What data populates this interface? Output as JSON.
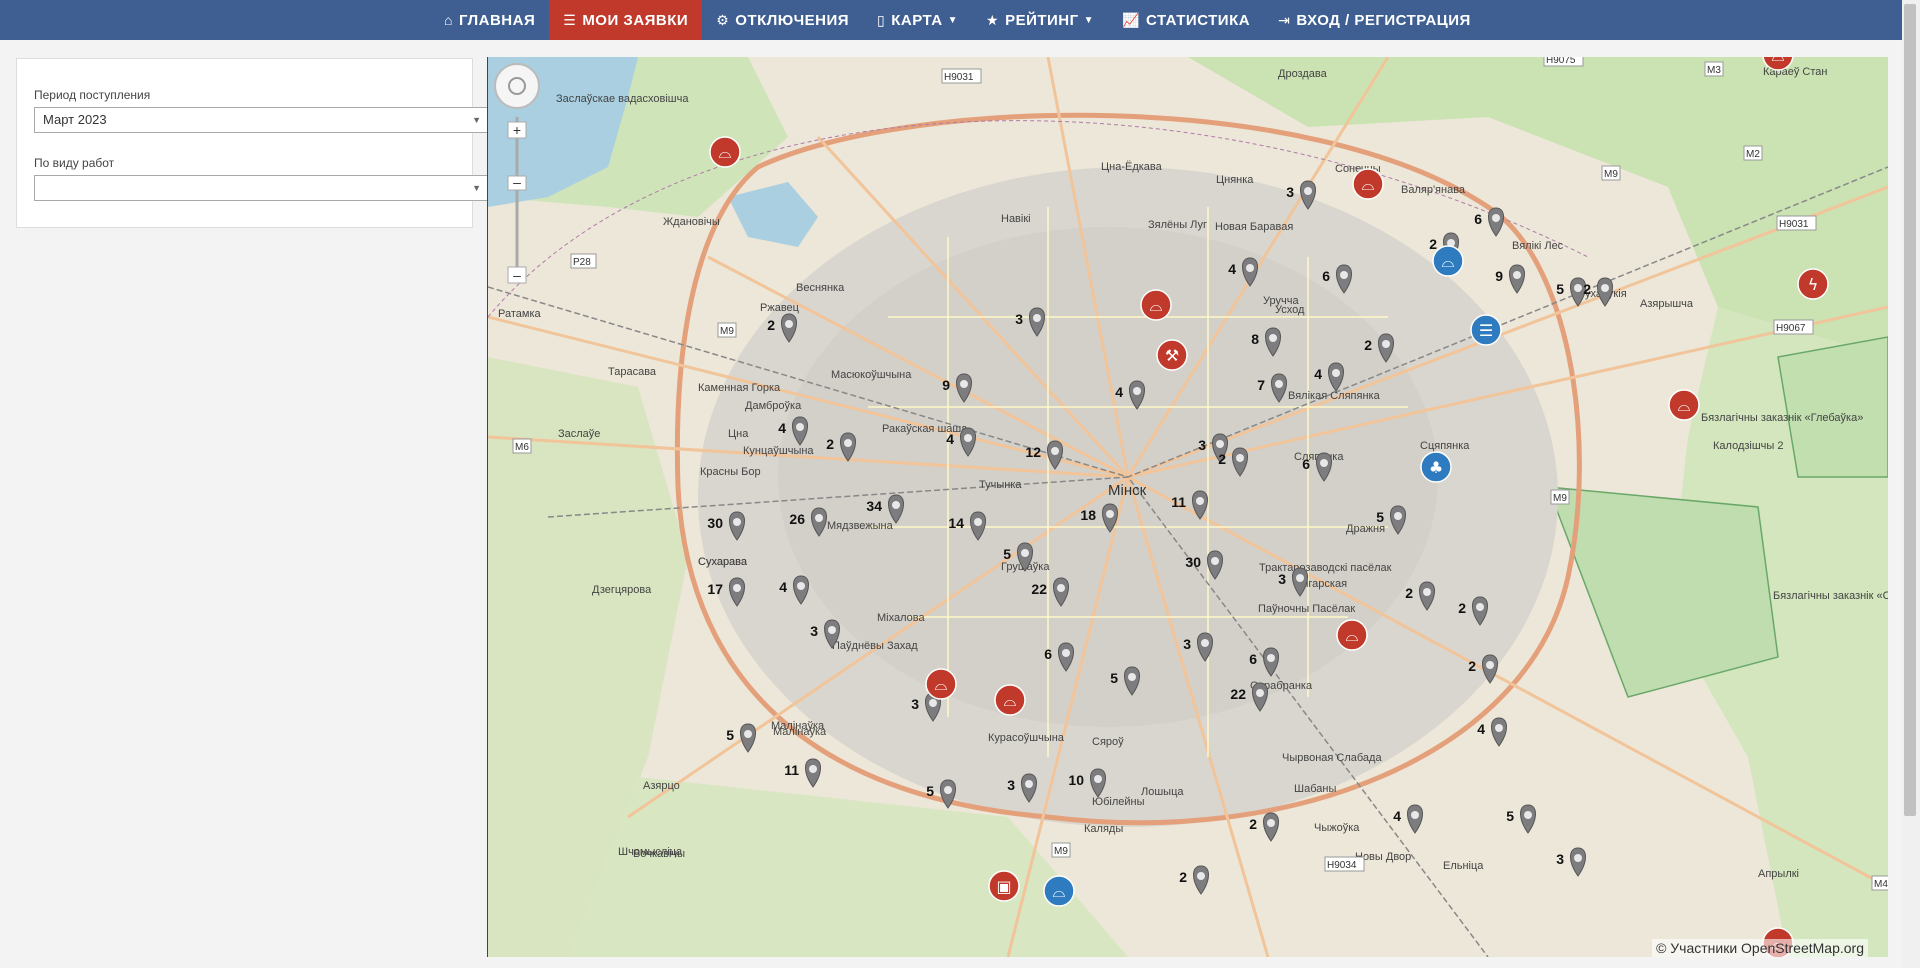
{
  "nav": {
    "items": [
      {
        "label": "ГЛАВНАЯ",
        "icon": "home-icon"
      },
      {
        "label": "МОИ ЗАЯВКИ",
        "icon": "list-icon",
        "active": true
      },
      {
        "label": "ОТКЛЮЧЕНИЯ",
        "icon": "gear-icon"
      },
      {
        "label": "КАРТА",
        "icon": "map-icon",
        "dropdown": true
      },
      {
        "label": "РЕЙТИНГ",
        "icon": "star-icon",
        "dropdown": true
      },
      {
        "label": "СТАТИСТИКА",
        "icon": "chart-icon"
      },
      {
        "label": "ВХОД / РЕГИСТРАЦИЯ",
        "icon": "login-icon"
      }
    ],
    "active_color": "#c0392b",
    "bar_color": "#3f5f92"
  },
  "filter": {
    "period_label": "Период поступления",
    "period_value": "Март 2023",
    "work_type_label": "По виду работ",
    "work_type_value": ""
  },
  "map": {
    "attribution": "© Участники OpenStreetMap.org",
    "city_label": "Мінск",
    "place_labels": [
      "Заслаўскае вадасховішча",
      "Ждановічы",
      "Веснянка",
      "Ржавец",
      "Масюкоўшчына",
      "Каменная Горка",
      "Дамброўка",
      "Ракаўская шаша",
      "Кунцаўшчына",
      "Красны Бор",
      "Тучынка",
      "Сухарава",
      "Мядзвежына",
      "Грушаўка",
      "Міхалова",
      "Паўднёвы Захад",
      "Малінаўка",
      "Курасоўшчына",
      "Сяроў",
      "Лошыца",
      "Навікі",
      "Цна-Ёдкава",
      "Зялёны Луг",
      "Новая Баравая",
      "Уручча",
      "Усход",
      "Вялікая Сляпянка",
      "Сляпянка",
      "Тракта­розаводскі пасёлак",
      "Серабранка",
      "Чырвоная Слабада",
      "Шабаны",
      "Ангарская",
      "Паўночны Пасёлак",
      "Сцяпянка",
      "Дражня",
      "Цнянка",
      "Сонечны",
      "Валяр'янава",
      "Вялікі Лес",
      "Сухарукія",
      "Азярышча",
      "Калодзішчы 2",
      "Бязлагічны заказнік «Глебаўка»",
      "Бязлагічны заказнік «Сціклева»",
      "Тарасава",
      "Ратамка",
      "Дзегцярова",
      "Азярцо",
      "Малінаўка",
      "Шчомысліца",
      "Вочкавічы",
      "Юбілейны",
      "Каляды",
      "Чыжоўка",
      "Новы Двор",
      "Ельніца",
      "Апрылкі",
      "Караеў Стан",
      "Дроздава",
      "Цна",
      "Сухарава",
      "Заслаўе"
    ],
    "road_labels": [
      "H9031",
      "H9075",
      "M3",
      "M2",
      "H9031",
      "H9067",
      "P28",
      "M9",
      "M6",
      "M9",
      "M9",
      "H9034",
      "M4",
      "M9"
    ],
    "markers": [
      {
        "type": "count",
        "value": "3"
      },
      {
        "type": "count",
        "value": "6"
      },
      {
        "type": "count",
        "value": "2"
      },
      {
        "type": "count",
        "value": "4"
      },
      {
        "type": "count",
        "value": "6"
      },
      {
        "type": "count",
        "value": "9"
      },
      {
        "type": "count",
        "value": "5"
      },
      {
        "type": "count",
        "value": "2"
      },
      {
        "type": "count",
        "value": "3"
      },
      {
        "type": "count",
        "value": "8"
      },
      {
        "type": "count",
        "value": "2"
      },
      {
        "type": "count",
        "value": "4"
      },
      {
        "type": "count",
        "value": "9"
      },
      {
        "type": "count",
        "value": "4"
      },
      {
        "type": "count",
        "value": "7"
      },
      {
        "type": "count",
        "value": "4"
      },
      {
        "type": "count",
        "value": "2"
      },
      {
        "type": "count",
        "value": "3"
      },
      {
        "type": "count",
        "value": "12"
      },
      {
        "type": "count",
        "value": "4"
      },
      {
        "type": "count",
        "value": "6"
      },
      {
        "type": "count",
        "value": "2"
      },
      {
        "type": "count",
        "value": "11"
      },
      {
        "type": "count",
        "value": "18"
      },
      {
        "type": "count",
        "value": "34"
      },
      {
        "type": "count",
        "value": "26"
      },
      {
        "type": "count",
        "value": "30"
      },
      {
        "type": "count",
        "value": "14"
      },
      {
        "type": "count",
        "value": "5"
      },
      {
        "type": "count",
        "value": "30"
      },
      {
        "type": "count",
        "value": "5"
      },
      {
        "type": "count",
        "value": "3"
      },
      {
        "type": "count",
        "value": "17"
      },
      {
        "type": "count",
        "value": "4"
      },
      {
        "type": "count",
        "value": "22"
      },
      {
        "type": "count",
        "value": "2"
      },
      {
        "type": "count",
        "value": "2"
      },
      {
        "type": "count",
        "value": "3"
      },
      {
        "type": "count",
        "value": "6"
      },
      {
        "type": "count",
        "value": "3"
      },
      {
        "type": "count",
        "value": "6"
      },
      {
        "type": "count",
        "value": "5"
      },
      {
        "type": "count",
        "value": "2"
      },
      {
        "type": "count",
        "value": "3"
      },
      {
        "type": "count",
        "value": "22"
      },
      {
        "type": "count",
        "value": "5"
      },
      {
        "type": "count",
        "value": "4"
      },
      {
        "type": "count",
        "value": "11"
      },
      {
        "type": "count",
        "value": "5"
      },
      {
        "type": "count",
        "value": "3"
      },
      {
        "type": "count",
        "value": "10"
      },
      {
        "type": "count",
        "value": "2"
      },
      {
        "type": "count",
        "value": "4"
      },
      {
        "type": "count",
        "value": "5"
      },
      {
        "type": "count",
        "value": "3"
      },
      {
        "type": "count",
        "value": "2"
      },
      {
        "type": "count",
        "value": "2"
      }
    ],
    "icon_markers": [
      {
        "kind": "road-work-icon",
        "color": "#c0392b"
      },
      {
        "kind": "road-work-icon",
        "color": "#c0392b"
      },
      {
        "kind": "road-work-icon",
        "color": "#c0392b"
      },
      {
        "kind": "cleaning-icon",
        "color": "#c0392b"
      },
      {
        "kind": "electricity-icon",
        "color": "#c0392b"
      },
      {
        "kind": "road-work-icon",
        "color": "#c0392b"
      },
      {
        "kind": "road-work-icon",
        "color": "#c0392b"
      },
      {
        "kind": "road-work-icon",
        "color": "#c0392b"
      },
      {
        "kind": "road-work-icon",
        "color": "#c0392b"
      },
      {
        "kind": "transport-icon",
        "color": "#c0392b"
      },
      {
        "kind": "road-work-icon",
        "color": "#2e7bbf"
      },
      {
        "kind": "list-icon",
        "color": "#2e7bbf"
      },
      {
        "kind": "tree-icon",
        "color": "#2e7bbf"
      },
      {
        "kind": "road-work-icon",
        "color": "#2e7bbf"
      },
      {
        "kind": "road-work-icon",
        "color": "#c0392b"
      },
      {
        "kind": "road-work-icon",
        "color": "#c0392b"
      }
    ]
  }
}
